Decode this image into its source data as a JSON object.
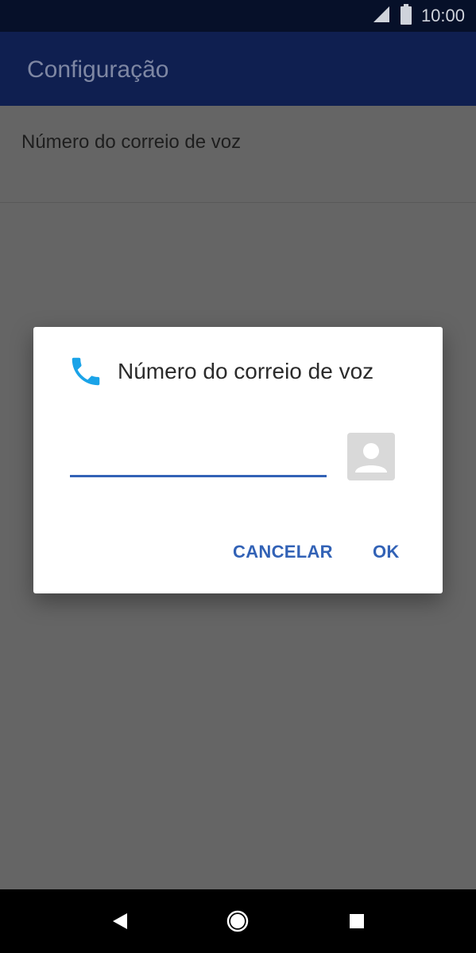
{
  "status_bar": {
    "time": "10:00",
    "icons": [
      "signal-icon",
      "battery-icon"
    ]
  },
  "app_bar": {
    "title": "Configuração"
  },
  "settings": {
    "items": [
      {
        "label": "Número do correio de voz"
      }
    ]
  },
  "dialog": {
    "title": "Número do correio de voz",
    "icon": "phone-icon",
    "input": {
      "value": "",
      "placeholder": ""
    },
    "contact_icon": "contact-picker-icon",
    "cancel_label": "CANCELAR",
    "ok_label": "OK"
  },
  "nav_bar": {
    "icons": [
      "back-icon",
      "home-icon",
      "recents-icon"
    ]
  },
  "colors": {
    "status_bar": "#061029",
    "app_bar": "#0f1f50",
    "accent": "#3262b6",
    "phone_icon": "#1aa3e8",
    "scrim": "#656565"
  }
}
